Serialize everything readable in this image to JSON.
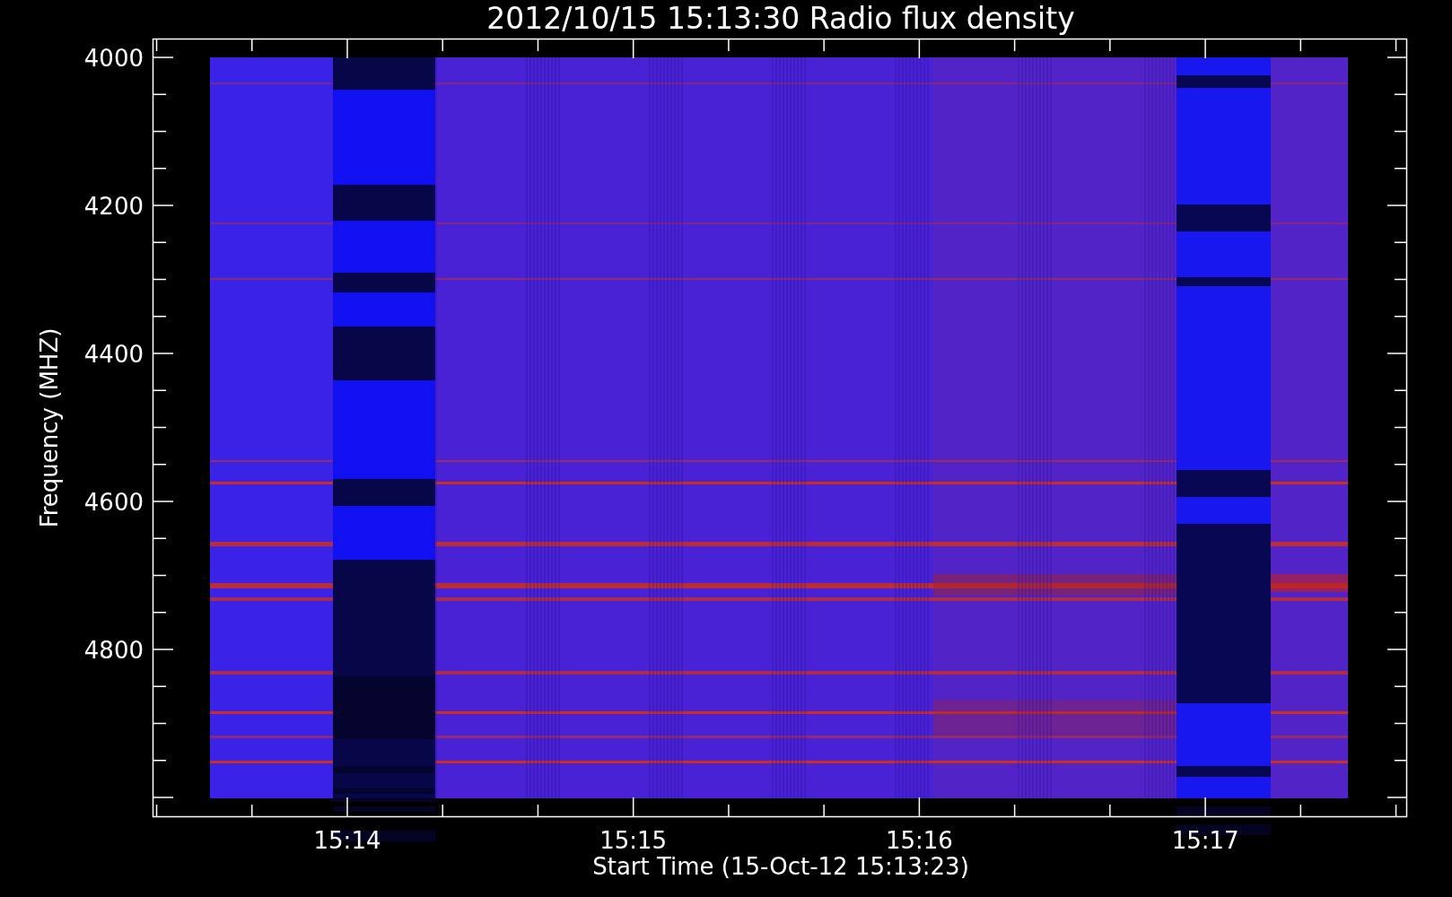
{
  "plot": {
    "title": "2012/10/15 15:13:30 Radio flux density",
    "ylabel": "Frequency (MHZ)",
    "xlabel": "Start Time (15-Oct-12 15:13:23)",
    "yticks": [
      "4000",
      "4200",
      "4400",
      "4600",
      "4800"
    ],
    "xticks": [
      "15:14",
      "15:15",
      "15:16",
      "15:17"
    ]
  }
}
